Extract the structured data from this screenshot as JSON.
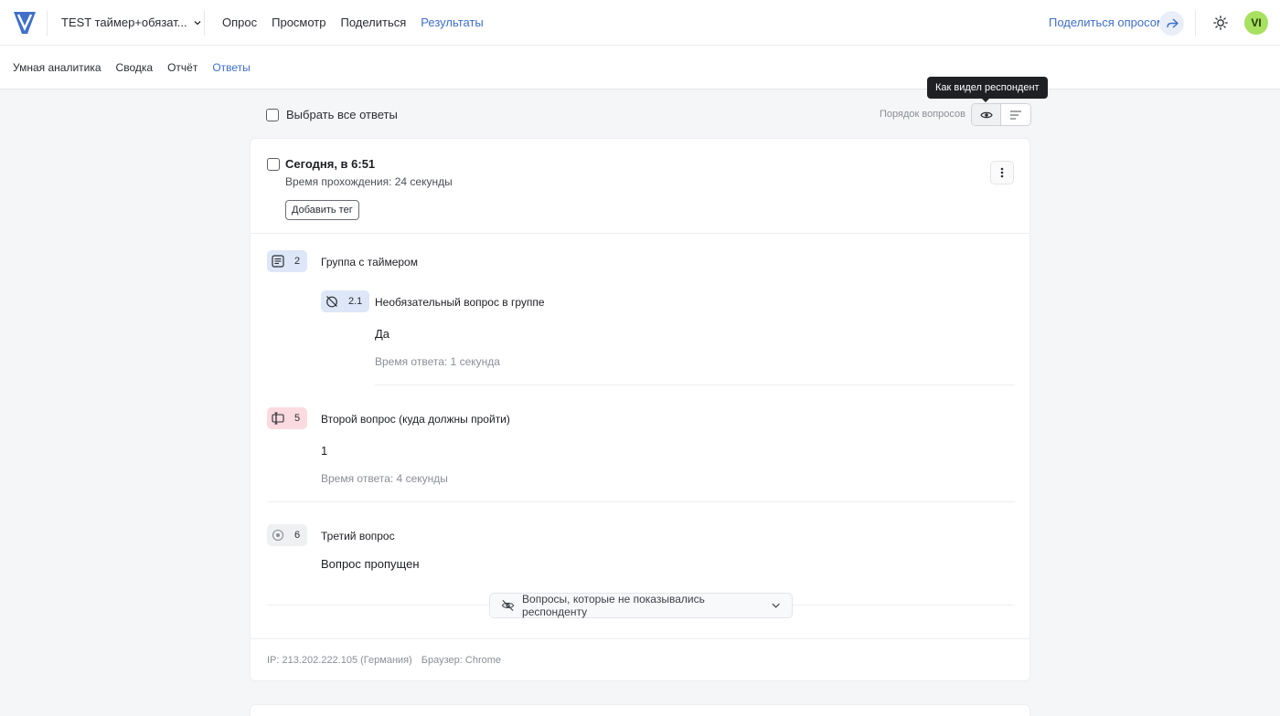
{
  "header": {
    "survey_title": "TEST таймер+обязат...",
    "nav": [
      "Опрос",
      "Просмотр",
      "Поделиться",
      "Результаты"
    ],
    "active_nav": "Результаты",
    "share_label": "Поделиться опросом",
    "avatar_initials": "VI",
    "accent_color": "#3f6fc9"
  },
  "subnav": {
    "items": [
      "Умная аналитика",
      "Сводка",
      "Отчёт",
      "Ответы"
    ],
    "active": "Ответы"
  },
  "toolbar": {
    "select_all_label": "Выбрать все ответы",
    "order_label": "Порядок вопросов",
    "tooltip": "Как видел респондент"
  },
  "response": {
    "date": "Сегодня, в 6:51",
    "duration": "Время прохождения: 24 секунды",
    "add_tag_label": "Добавить тег",
    "group": {
      "number": "2",
      "title": "Группа с таймером",
      "question": {
        "number": "2.1",
        "title": "Необязательный вопрос в группе",
        "answer": "Да",
        "time": "Время ответа: 1 секунда"
      }
    },
    "q5": {
      "number": "5",
      "title": "Второй вопрос (куда должны пройти)",
      "answer": "1",
      "time": "Время ответа: 4 секунды"
    },
    "q6": {
      "number": "6",
      "title": "Третий вопрос",
      "answer": "Вопрос пропущен"
    },
    "hidden_questions_label": "Вопросы, которые не показывались респонденту",
    "ip": "IP: 213.202.222.105 (Германия)",
    "browser": "Браузер: Chrome"
  }
}
